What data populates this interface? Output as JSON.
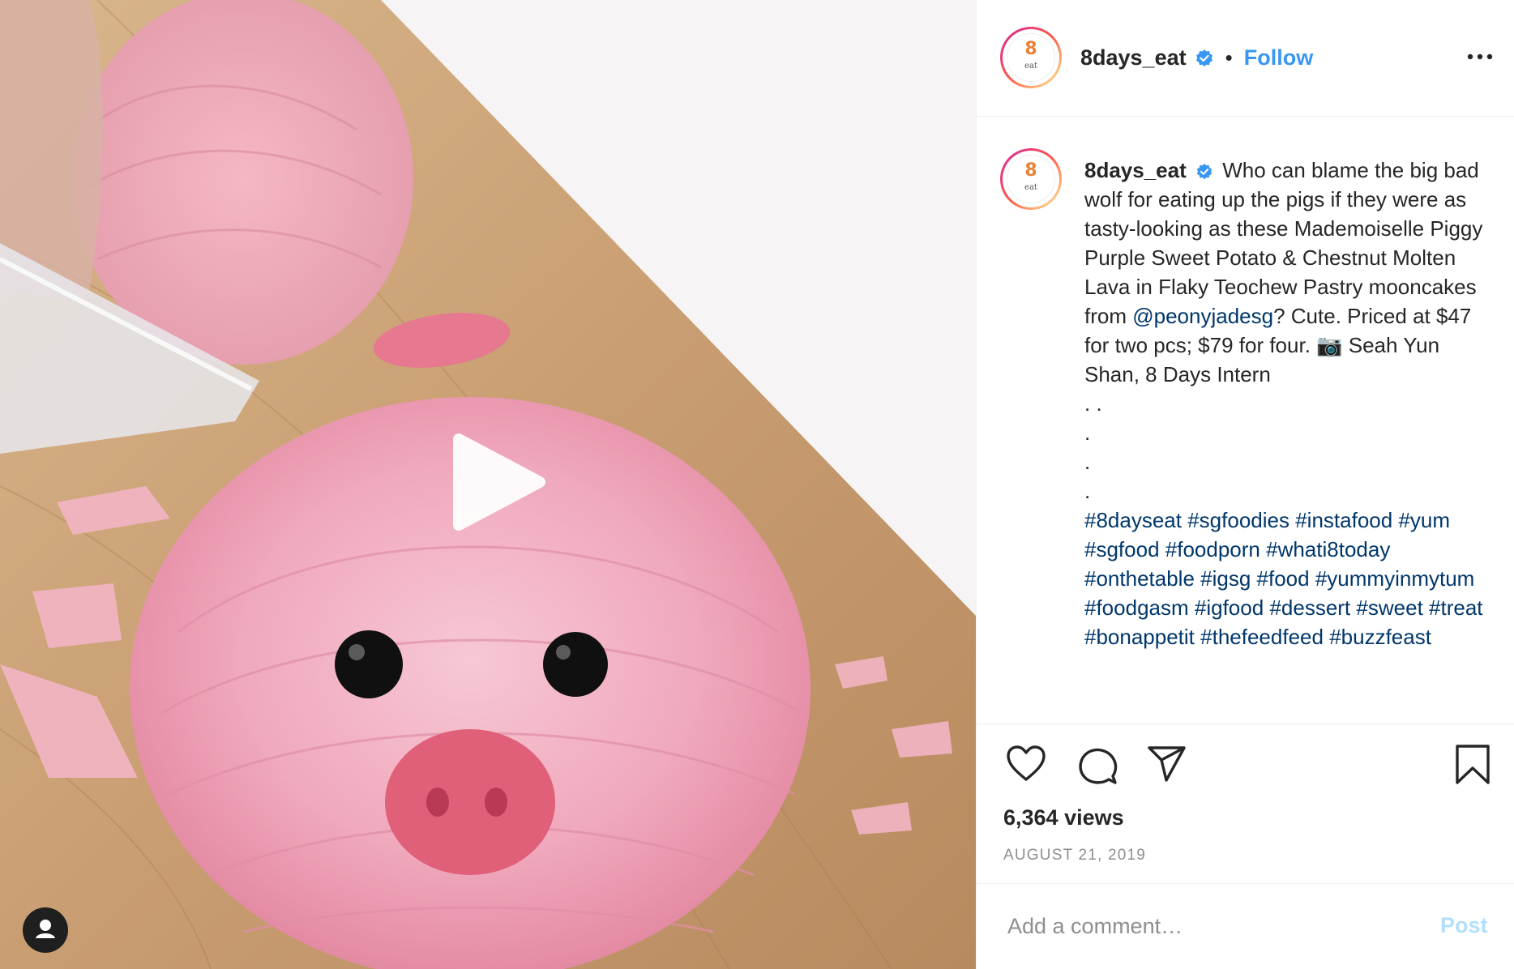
{
  "media": {
    "type": "video",
    "subject": "pink pig-shaped flaky mooncake on a wooden board",
    "play_icon": "play-icon",
    "user_tag_icon": "user-tag-icon"
  },
  "header": {
    "avatar_label": "8",
    "avatar_sub": "eat",
    "username": "8days_eat",
    "verified_icon": "verified-badge-icon",
    "separator": "•",
    "follow_label": "Follow",
    "more_icon": "more-options-icon"
  },
  "caption": {
    "username": "8days_eat",
    "text_before_mention": "Who can blame the big bad wolf for eating up the pigs if they were as tasty-looking as these Mademoiselle Piggy Purple Sweet Potato & Chestnut Molten Lava in Flaky Teochew Pastry mooncakes from",
    "mention": "@peonyjadesg",
    "text_after_mention": "? Cute. Priced at $47 for two pcs; $79 for four. 📷 Seah Yun Shan, 8 Days Intern",
    "dots": [
      ". .",
      ".",
      ".",
      "."
    ],
    "hashtags": [
      "#8dayseat",
      "#sgfoodies",
      "#instafood",
      "#yum",
      "#sgfood",
      "#foodporn",
      "#whati8today",
      "#onthetable",
      "#igsg",
      "#food",
      "#yummyinmytum",
      "#foodgasm",
      "#igfood",
      "#dessert",
      "#sweet",
      "#treat",
      "#bonappetit",
      "#thefeedfeed",
      "#buzzfeast"
    ]
  },
  "actions": {
    "like_icon": "heart-icon",
    "comment_icon": "comment-icon",
    "share_icon": "share-icon",
    "save_icon": "bookmark-icon"
  },
  "stats": {
    "views": "6,364 views",
    "date": "AUGUST 21, 2019"
  },
  "comment_box": {
    "placeholder": "Add a comment…",
    "post_label": "Post"
  },
  "colors": {
    "link": "#00376b",
    "follow": "#3897f0",
    "post_disabled": "#b2dffc",
    "muted": "#8e8e8e",
    "text": "#262626"
  }
}
